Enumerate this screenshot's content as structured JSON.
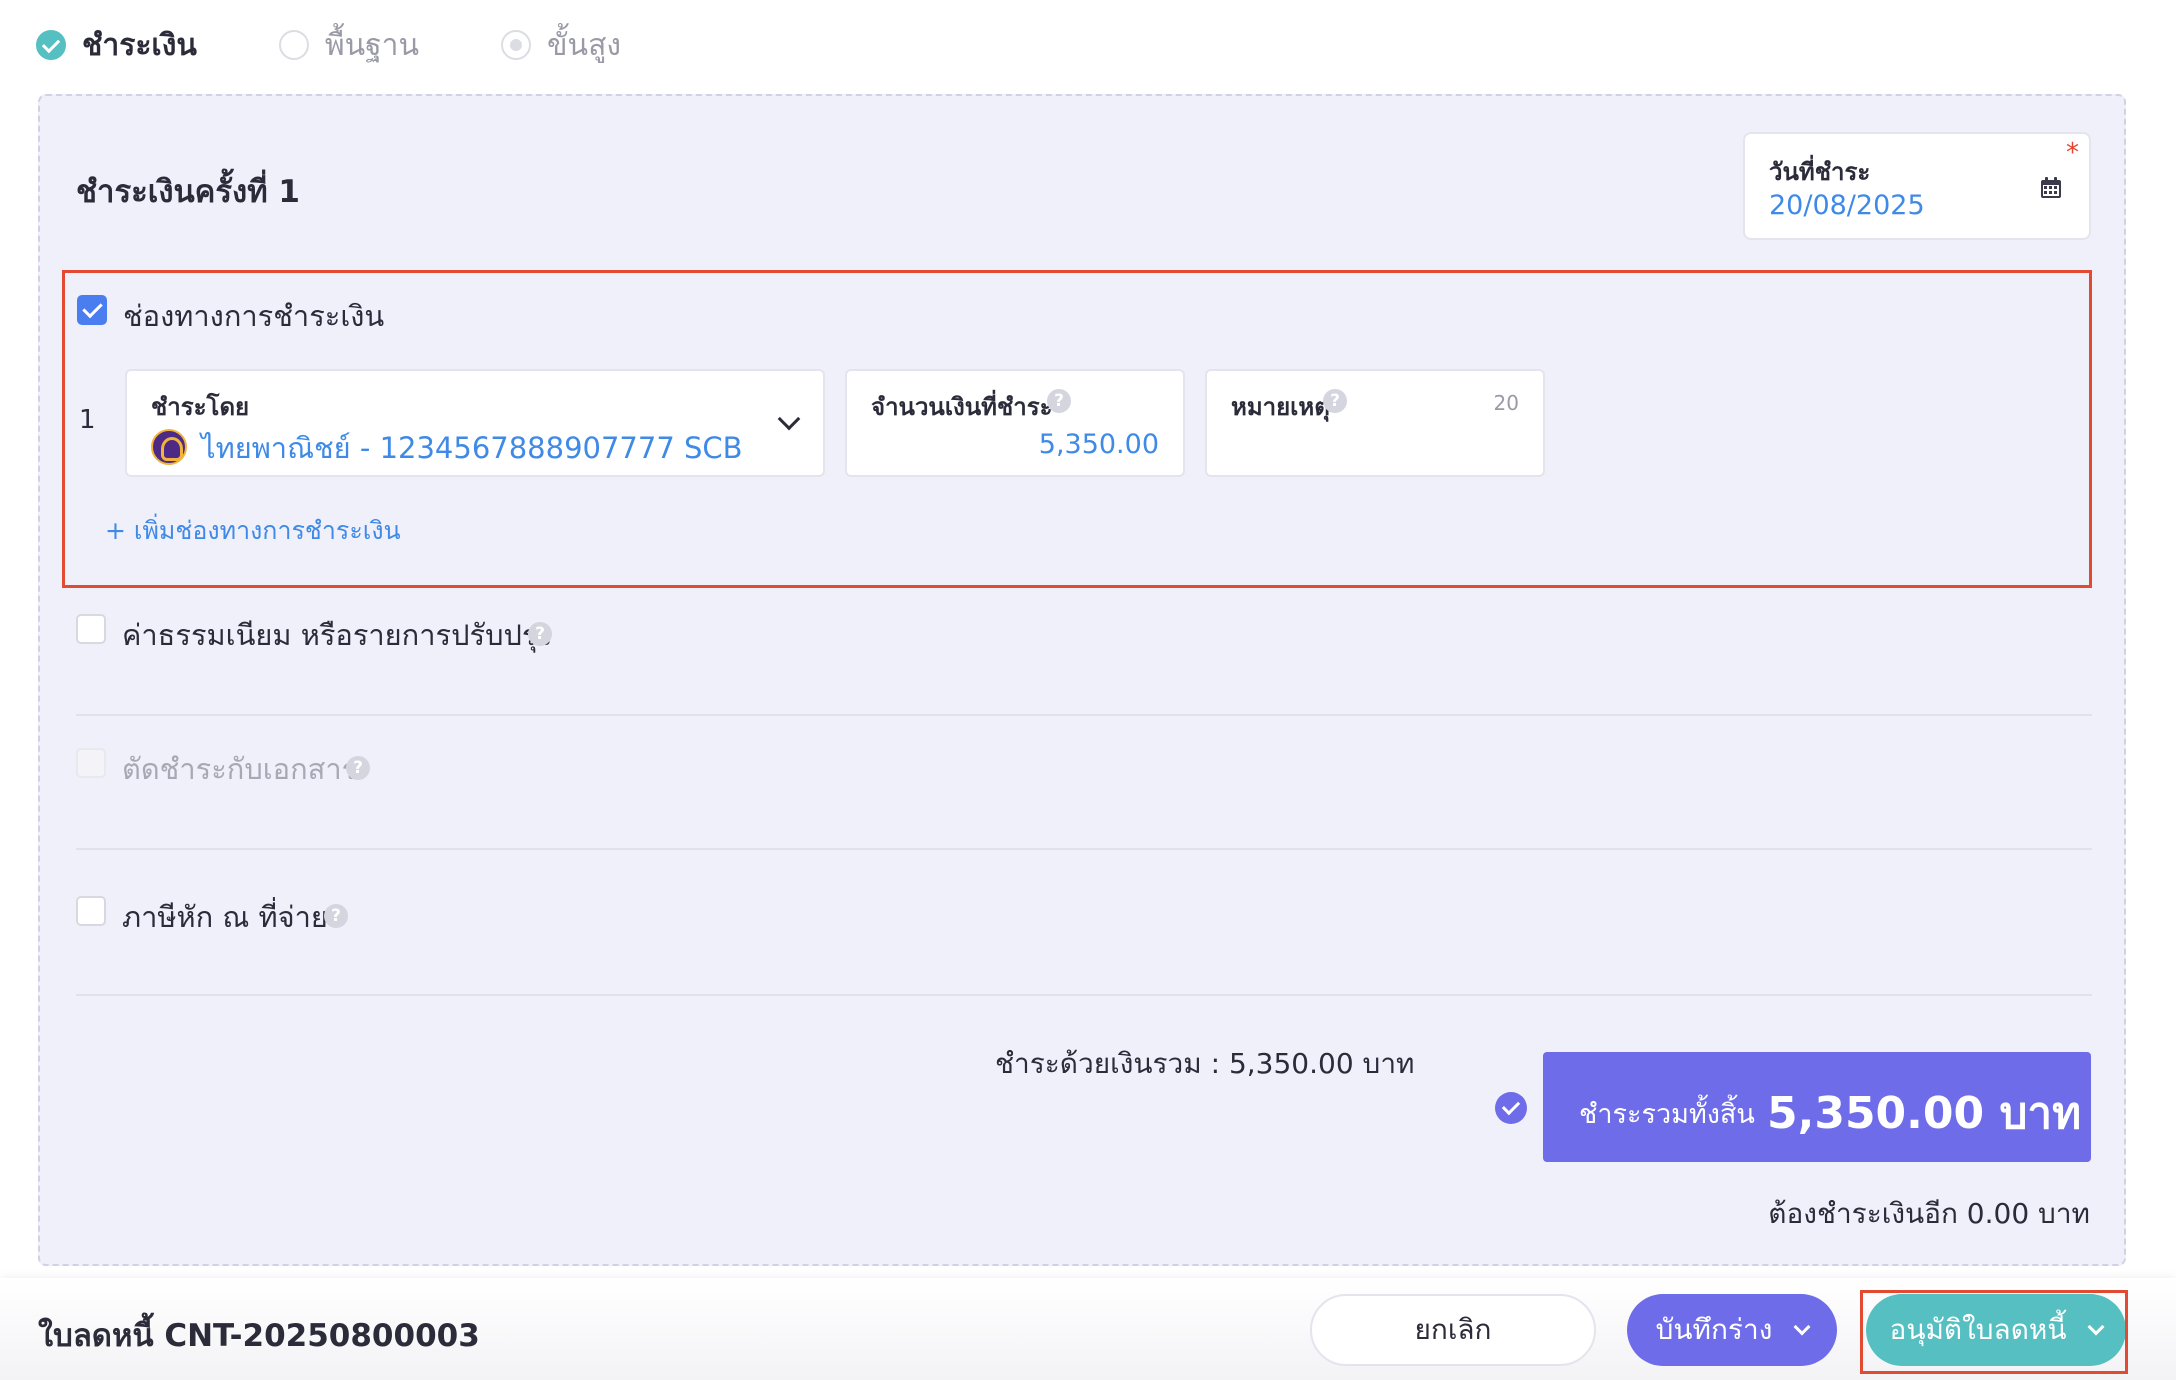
{
  "modes": [
    {
      "label": "ชำระเงิน",
      "selected": true
    },
    {
      "label": "พื้นฐาน",
      "selected": false
    },
    {
      "label": "ขั้นสูง",
      "selected": false
    }
  ],
  "section_title": "ชำระเงินครั้งที่ 1",
  "payment_date": {
    "label": "วันที่ชำระ",
    "required": "*",
    "value": "20/08/2025"
  },
  "payment_channel": {
    "checkbox_label": "ช่องทางการชำระเงิน",
    "checked": true,
    "row_number": "1",
    "pay_by": {
      "label": "ชำระโดย",
      "value": "ไทยพาณิชย์ - 1234567888907777 SCB"
    },
    "amount": {
      "label": "จำนวนเงินที่ชำระ",
      "value": "5,350.00"
    },
    "note": {
      "label": "หมายเหตุ",
      "char_limit": "20",
      "value": ""
    },
    "add_link": "+ เพิ่มช่องทางการชำระเงิน"
  },
  "fees": {
    "label": "ค่าธรรมเนียม หรือรายการปรับปรุง",
    "checked": false
  },
  "offset_docs": {
    "label": "ตัดชำระกับเอกสาร",
    "checked": false,
    "disabled": true
  },
  "withholding_tax": {
    "label": "ภาษีหัก ณ ที่จ่าย",
    "checked": false
  },
  "summary": {
    "paid_total_text": "ชำระด้วยเงินรวม :  5,350.00 บาท",
    "grand_total_label": "ชำระรวมทั้งสิ้น",
    "grand_total_value": "5,350.00 บาท",
    "remaining_text": "ต้องชำระเงินอีก 0.00 บาท"
  },
  "footer": {
    "doc_title": "ใบลดหนี้ CNT-20250800003",
    "cancel_label": "ยกเลิก",
    "draft_label": "บันทึกร่าง",
    "approve_label": "อนุมัติใบลดหนี้"
  },
  "colors": {
    "accent_purple": "#6e6ce8",
    "accent_teal": "#56bfc1",
    "link_blue": "#3f8ae6",
    "highlight_red": "#e24b32",
    "panel_bg": "#eff0fa"
  },
  "icons": [
    "check-circle-icon",
    "radio-icon",
    "calendar-icon",
    "help-icon",
    "chevron-down-icon",
    "bank-logo-icon",
    "plus-icon"
  ]
}
